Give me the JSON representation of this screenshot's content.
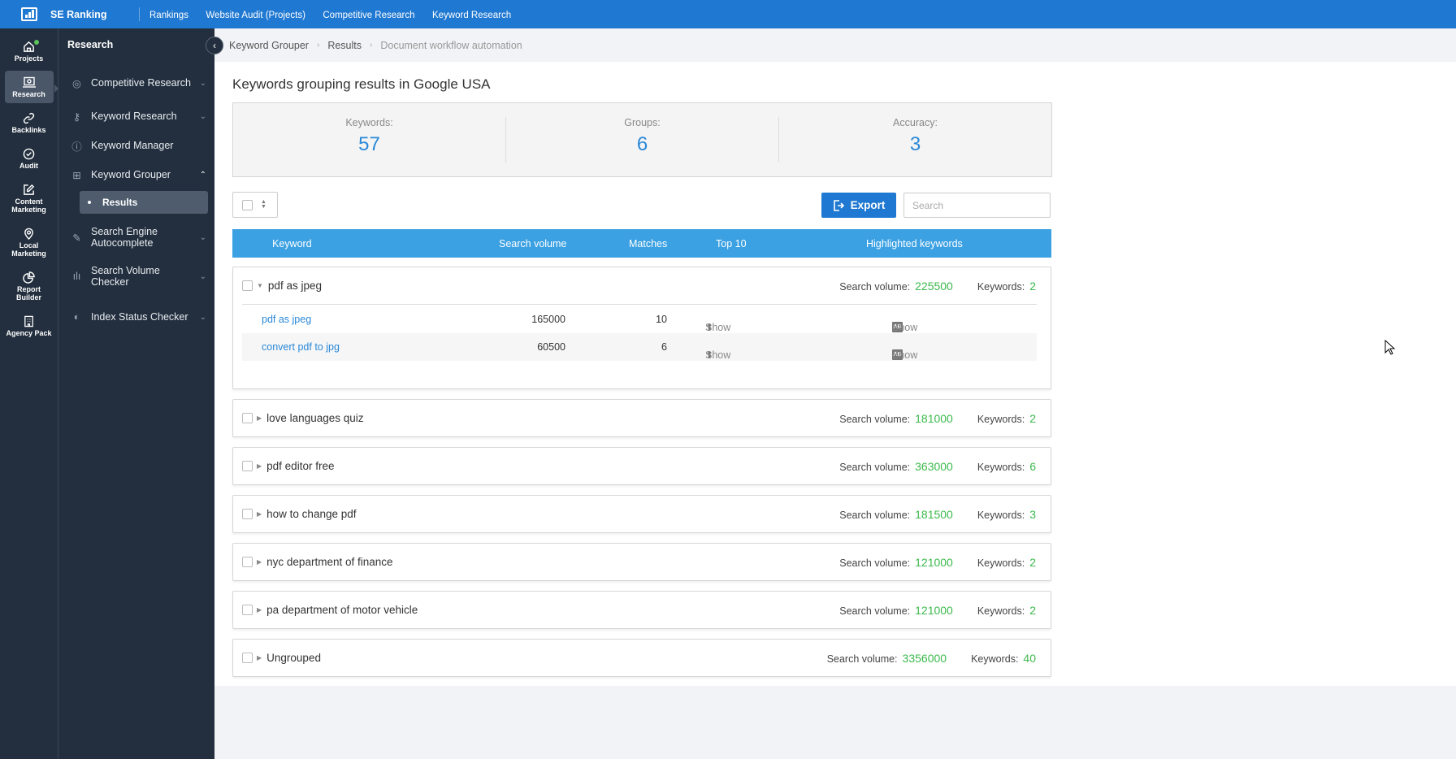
{
  "topbar": {
    "brand": "SE Ranking",
    "nav": [
      "Rankings",
      "Website Audit (Projects)",
      "Competitive Research",
      "Keyword Research"
    ]
  },
  "rail": [
    {
      "label": "Projects",
      "icon": "home-icon"
    },
    {
      "label": "Research",
      "icon": "research-icon",
      "active": true
    },
    {
      "label": "Backlinks",
      "icon": "link-icon"
    },
    {
      "label": "Audit",
      "icon": "check-circle-icon"
    },
    {
      "label": "Content Marketing",
      "icon": "edit-icon"
    },
    {
      "label": "Local Marketing",
      "icon": "map-pin-icon"
    },
    {
      "label": "Report Builder",
      "icon": "pie-chart-icon"
    },
    {
      "label": "Agency Pack",
      "icon": "building-icon"
    }
  ],
  "subnav": {
    "title": "Research",
    "items": [
      {
        "label": "Competitive Research",
        "icon": "target-icon",
        "chevron": "down"
      },
      {
        "label": "Keyword Research",
        "icon": "key-icon",
        "chevron": "down"
      },
      {
        "label": "Keyword Manager",
        "icon": "info-circle-icon",
        "chevron": ""
      },
      {
        "label": "Keyword Grouper",
        "icon": "folder-plus-icon",
        "chevron": "up"
      },
      {
        "label": "Search Engine Autocomplete",
        "icon": "pencil-icon",
        "chevron": "down"
      },
      {
        "label": "Search Volume Checker",
        "icon": "bar-chart-icon",
        "chevron": "down"
      },
      {
        "label": "Index Status Checker",
        "icon": "gauge-icon",
        "chevron": "down"
      }
    ],
    "sub_item": "Results"
  },
  "breadcrumb": [
    "Keyword Grouper",
    "Results",
    "Document workflow automation"
  ],
  "page_title": "Keywords grouping results in Google USA",
  "stats": [
    {
      "label": "Keywords:",
      "value": "57"
    },
    {
      "label": "Groups:",
      "value": "6"
    },
    {
      "label": "Accuracy:",
      "value": "3"
    }
  ],
  "toolbar": {
    "export_label": "Export",
    "search_placeholder": "Search",
    "search_value": ""
  },
  "table": {
    "columns": [
      "Keyword",
      "Search volume",
      "Matches",
      "Top 10",
      "Highlighted keywords"
    ],
    "sv_label": "Search volume:",
    "kw_label": "Keywords:",
    "show_label": "Show",
    "groups": [
      {
        "name": "pdf as jpeg",
        "search_volume": "225500",
        "keywords": "2",
        "expanded": true,
        "rows": [
          {
            "keyword": "pdf as jpeg",
            "volume": "165000",
            "matches": "10"
          },
          {
            "keyword": "convert pdf to jpg",
            "volume": "60500",
            "matches": "6"
          }
        ]
      },
      {
        "name": "love languages quiz",
        "search_volume": "181000",
        "keywords": "2"
      },
      {
        "name": "pdf editor free",
        "search_volume": "363000",
        "keywords": "6"
      },
      {
        "name": "how to change pdf",
        "search_volume": "181500",
        "keywords": "3"
      },
      {
        "name": "nyc department of finance",
        "search_volume": "121000",
        "keywords": "2"
      },
      {
        "name": "pa department of motor vehicle",
        "search_volume": "121000",
        "keywords": "2"
      },
      {
        "name": "Ungrouped",
        "search_volume": "3356000",
        "keywords": "40"
      }
    ]
  },
  "colors": {
    "brand": "#1f78d1",
    "table_header": "#3ba1e3",
    "accent_number": "#2a88d8",
    "positive": "#3cb94c",
    "sidebar": "#232f3e"
  }
}
